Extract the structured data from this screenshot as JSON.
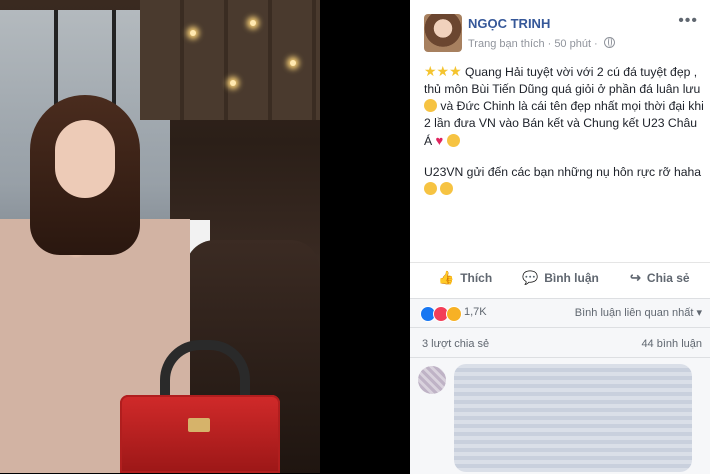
{
  "post": {
    "author": "NGỌC TRINH",
    "meta_prefix": "Trang bạn thích",
    "meta_time": "50 phút",
    "paragraph1": "Quang Hải tuyệt vời với 2 cú đá tuyệt đẹp , thủ môn Bùi Tiến Dũng quá giỏi ở phần đá luân lưu",
    "paragraph1b": "và Đức Chinh là cái tên đẹp nhất mọi thời đại khi 2 lần đưa VN vào Bán kết và Chung kết U23 Châu Á",
    "paragraph2": "U23VN gửi đến các bạn những nụ hôn rực rỡ haha"
  },
  "actions": {
    "like": "Thích",
    "comment": "Bình luận",
    "share": "Chia sẻ"
  },
  "reactions": {
    "count": "1,7K",
    "sort_label": "Bình luận liên quan nhất ▾"
  },
  "stats": {
    "shares": "3 lượt chia sẻ",
    "comments": "44 bình luận"
  },
  "icons": {
    "more": "more-icon",
    "globe": "globe-icon",
    "like": "thumbs-up-icon",
    "comment": "comment-icon",
    "share": "share-icon"
  }
}
